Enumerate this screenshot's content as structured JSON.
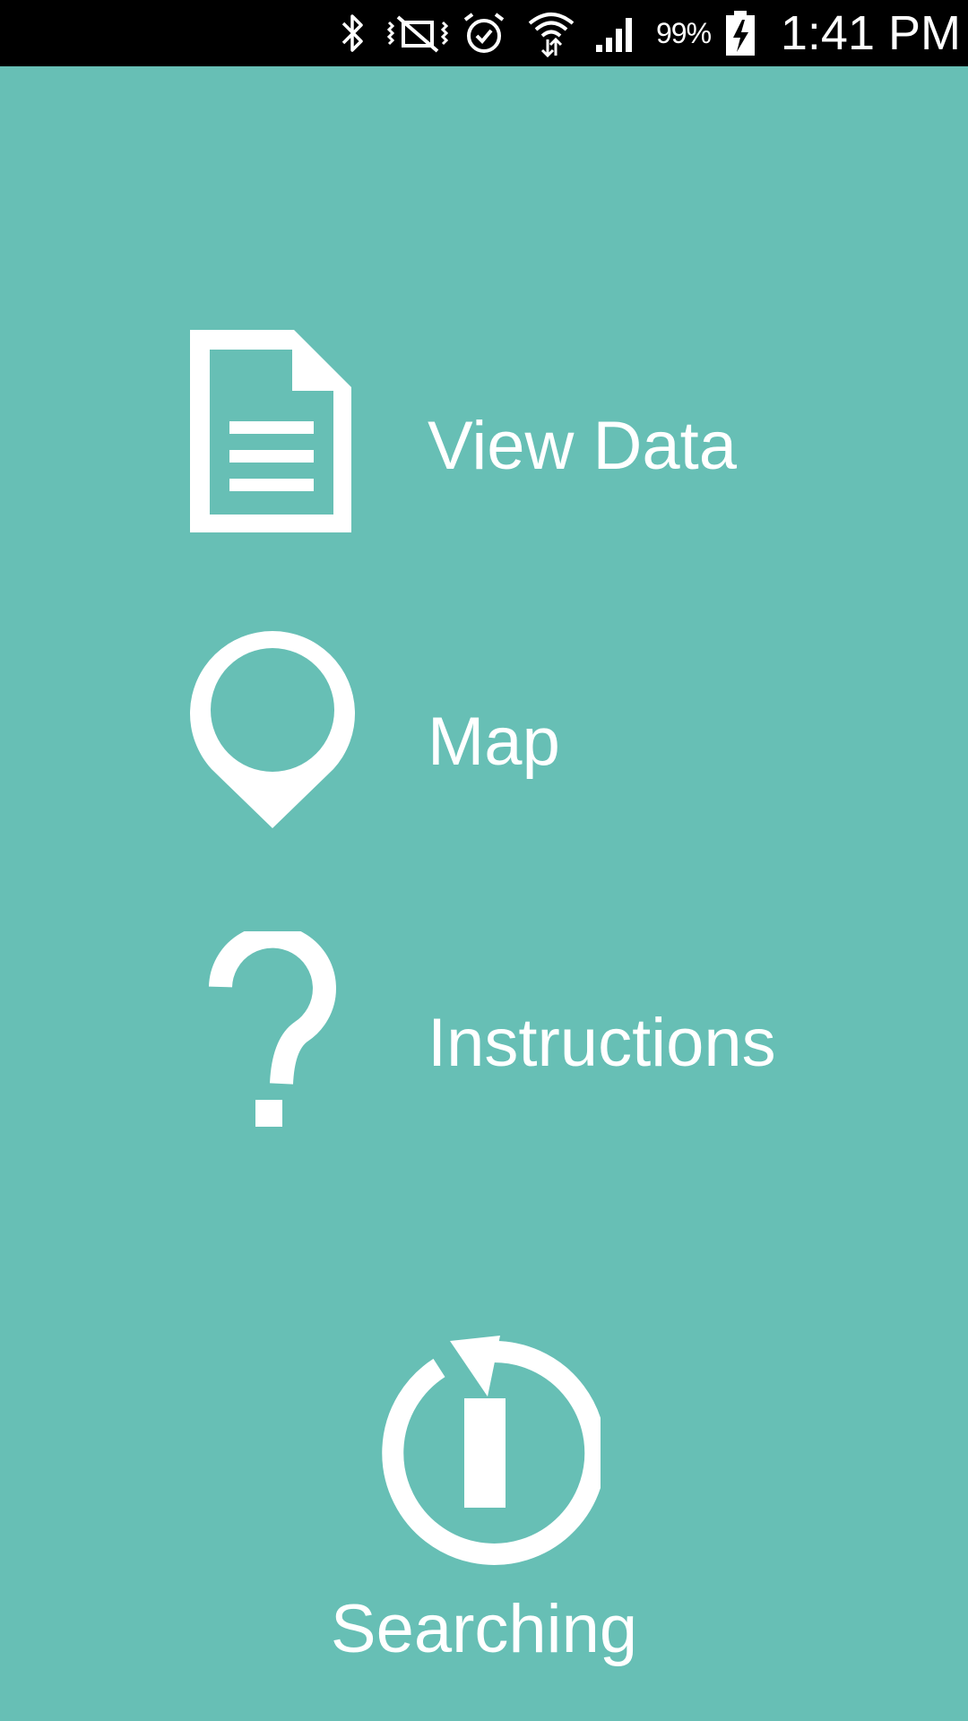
{
  "status_bar": {
    "icons": [
      "bluetooth-icon",
      "vibrate-icon",
      "alarm-icon",
      "wifi-icon",
      "signal-icon",
      "battery-charging-icon"
    ],
    "battery_percent": "99%",
    "time": "1:41 PM"
  },
  "menu": {
    "items": [
      {
        "label": "View Data",
        "icon": "document-icon"
      },
      {
        "label": "Map",
        "icon": "map-pin-icon"
      },
      {
        "label": "Instructions",
        "icon": "question-mark-icon"
      }
    ]
  },
  "search": {
    "label": "Searching",
    "icon": "sync-power-icon"
  },
  "colors": {
    "background": "#67bfb5",
    "foreground": "#ffffff",
    "status_bar": "#000000"
  }
}
